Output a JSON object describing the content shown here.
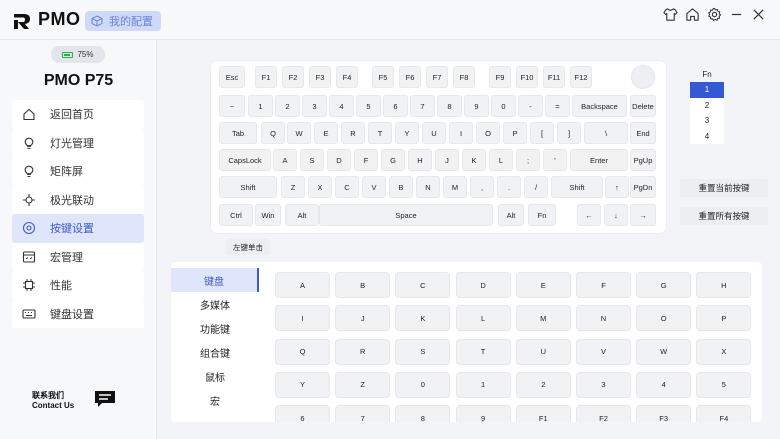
{
  "header": {
    "brand": "PMO",
    "my_config": "我的配置",
    "icons": [
      "skin-icon",
      "home-icon",
      "gear-icon",
      "minimize-icon",
      "close-icon"
    ]
  },
  "device": {
    "battery_percent": 75,
    "battery_label": "75%",
    "model": "PMO P75"
  },
  "nav": {
    "items": [
      {
        "label": "返回首页",
        "icon": "home-icon",
        "active": false
      },
      {
        "label": "灯光管理",
        "icon": "bulb-icon",
        "active": false
      },
      {
        "label": "矩阵屏",
        "icon": "bulb-icon",
        "active": false
      },
      {
        "label": "极光联动",
        "icon": "crosshair-icon",
        "active": false
      },
      {
        "label": "按键设置",
        "icon": "target-icon",
        "active": true
      },
      {
        "label": "宏管理",
        "icon": "macro-icon",
        "active": false
      },
      {
        "label": "性能",
        "icon": "chip-icon",
        "active": false
      },
      {
        "label": "键盘设置",
        "icon": "keyboard-icon",
        "active": false
      }
    ]
  },
  "contact": {
    "line1": "联系我们",
    "line2": "Contact Us"
  },
  "keyboard": {
    "rows": [
      [
        "Esc",
        "F1",
        "F2",
        "F3",
        "F4",
        "F5",
        "F6",
        "F7",
        "F8",
        "F9",
        "F10",
        "F11",
        "F12"
      ],
      [
        "~",
        "1",
        "2",
        "3",
        "4",
        "5",
        "6",
        "7",
        "8",
        "9",
        "0",
        "-",
        "=",
        "Backspace",
        "Delete"
      ],
      [
        "Tab",
        "Q",
        "W",
        "E",
        "R",
        "T",
        "Y",
        "U",
        "I",
        "O",
        "P",
        "[",
        "]",
        "\\",
        "End"
      ],
      [
        "CapsLock",
        "A",
        "S",
        "D",
        "F",
        "G",
        "H",
        "J",
        "K",
        "L",
        ";",
        "'",
        "Enter",
        "PgUp"
      ],
      [
        "Shift",
        "Z",
        "X",
        "C",
        "V",
        "B",
        "N",
        "M",
        ",",
        ".",
        "/",
        "Shift",
        "↑",
        "PgDn"
      ],
      [
        "Ctrl",
        "Win",
        "Alt",
        "Space",
        "Alt",
        "Fn",
        "←",
        "↓",
        "→"
      ]
    ],
    "action_label": "左键单击"
  },
  "layers": {
    "header": "Fn",
    "items": [
      "1",
      "2",
      "3",
      "4"
    ],
    "active_index": 0
  },
  "reset": {
    "current": "重置当前按键",
    "all": "重置所有按键"
  },
  "categories": {
    "items": [
      "键盘",
      "多媒体",
      "功能键",
      "组合键",
      "鼠标",
      "宏"
    ],
    "active_index": 0
  },
  "keygrid": {
    "keys": [
      "A",
      "B",
      "C",
      "D",
      "E",
      "F",
      "G",
      "H",
      "I",
      "J",
      "K",
      "L",
      "M",
      "N",
      "O",
      "P",
      "Q",
      "R",
      "S",
      "T",
      "U",
      "V",
      "W",
      "X",
      "Y",
      "Z",
      "0",
      "1",
      "2",
      "3",
      "4",
      "5",
      "6",
      "7",
      "8",
      "9",
      "F1",
      "F2",
      "F3",
      "F4"
    ]
  }
}
